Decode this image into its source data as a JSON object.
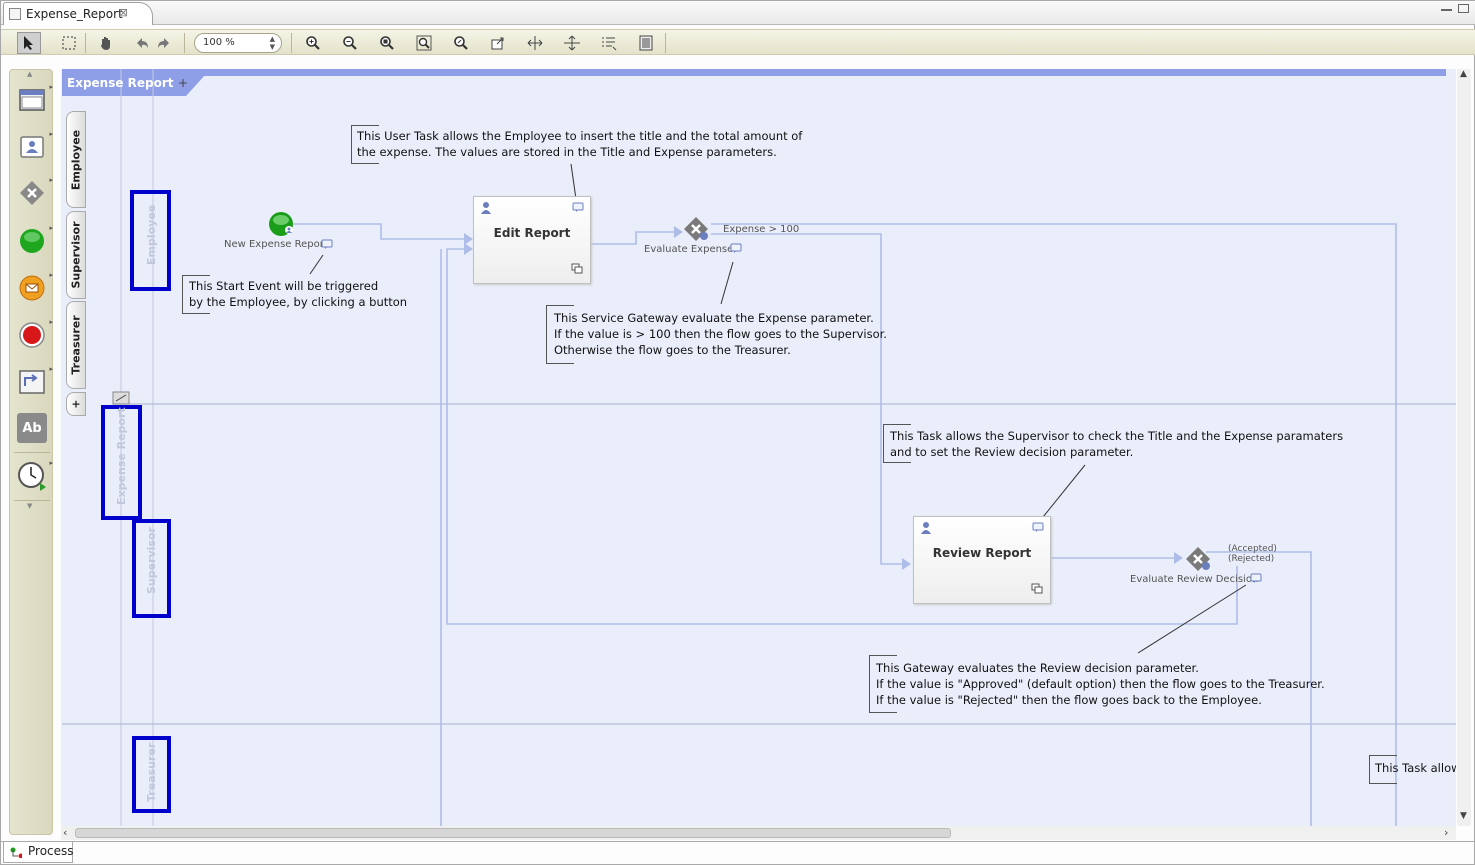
{
  "editor": {
    "tab_title": "Expense_Report",
    "close_glyph": "⊠"
  },
  "toolbar": {
    "zoom_value": "100 %",
    "tools": [
      "select-arrow-icon",
      "marquee-select-icon",
      "hand-pan-icon",
      "undo-icon",
      "redo-icon",
      "zoom-in-icon",
      "zoom-out-icon",
      "zoom-fit-icon",
      "zoom-selection-icon",
      "zoom-page-icon",
      "export-image-icon",
      "align-horizontal-icon",
      "align-vertical-icon",
      "layout-icon",
      "outline-icon"
    ]
  },
  "palette": {
    "items": [
      "lane-icon",
      "user-task-icon",
      "gateway-icon",
      "start-event-icon",
      "message-event-icon",
      "end-event-icon",
      "subprocess-icon",
      "text-annotation-icon",
      "timer-event-icon"
    ],
    "text_annotation_glyph": "Ab"
  },
  "side_tabs": {
    "employee": "Employee",
    "supervisor": "Supervisor",
    "treasurer": "Treasurer",
    "add": "+"
  },
  "diagram": {
    "pool_tab": "Expense Report",
    "pool_add": "+",
    "lane_labels": {
      "employee": "Employee",
      "pool": "Expense Report",
      "supervisor": "Supervisor",
      "treasurer": "Treasurer"
    },
    "start_event": "New Expense Report",
    "edit_task": "Edit Report",
    "evaluate_expense": "Evaluate Expense",
    "expense_condition": "Expense > 100",
    "review_task": "Review Report",
    "evaluate_review": "Evaluate Review Decision",
    "accepted": "(Accepted)",
    "rejected": "(Rejected)",
    "notes": {
      "edit_l1": "This User Task allows the Employee to insert the title and the total amount of",
      "edit_l2": "the expense. The values are stored in the Title and Expense parameters.",
      "start_l1": "This Start Event will be triggered",
      "start_l2": "by the Employee, by clicking a button",
      "gateway_l1": "This Service Gateway evaluate the Expense parameter.",
      "gateway_l2": "If the value is > 100 then the flow goes to the Supervisor.",
      "gateway_l3": "Otherwise the flow goes to the Treasurer.",
      "review_l1": "This Task allows the Supervisor to check the Title and the Expense paramaters",
      "review_l2": "and to set the Review decision parameter.",
      "review_gw_l1": "This Gateway evaluates the Review decision parameter.",
      "review_gw_l2": "If the value is \"Approved\" (default option) then the flow goes to the Treasurer.",
      "review_gw_l3": "If the value is \"Rejected\" then the flow goes back to the Employee.",
      "treasurer": "This Task allows"
    }
  },
  "bottom": {
    "tab": "Process"
  },
  "colors": {
    "pool_bg": "#eaeefb",
    "pool_strip": "#8e9fe8",
    "flow": "#aebde8",
    "highlight": "#0000cc",
    "start_green": "#1a9e1a"
  }
}
